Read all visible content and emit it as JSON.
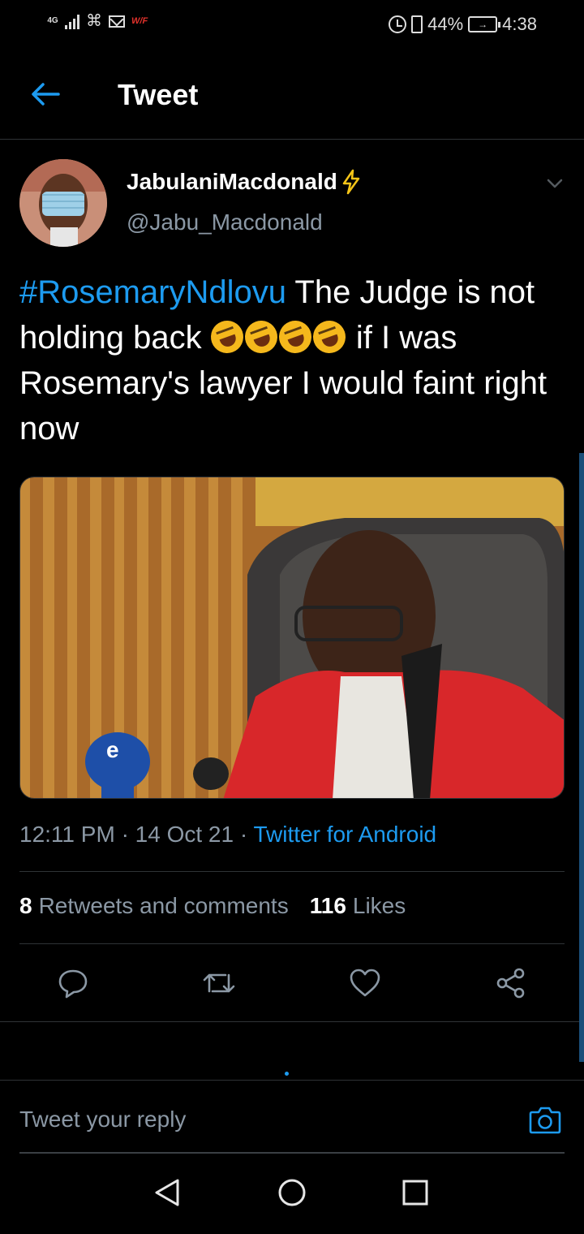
{
  "status_bar": {
    "network": "4G",
    "wifi_label": "W/F",
    "battery_percent": "44%",
    "time": "4:38"
  },
  "header": {
    "title": "Tweet"
  },
  "tweet": {
    "display_name": "JabulaniMacdonald",
    "handle": "@Jabu_Macdonald",
    "hashtag": "#RosemaryNdlovu",
    "text_part1": " The Judge is not holding back ",
    "text_part2": " if I was Rosemary's lawyer I would faint right now",
    "time": "12:11 PM",
    "date": "14 Oct 21",
    "source": "Twitter for Android",
    "retweets_count": "8",
    "retweets_label": "Retweets and comments",
    "likes_count": "116",
    "likes_label": "Likes"
  },
  "reply": {
    "placeholder": "Tweet your reply"
  },
  "colors": {
    "accent": "#1d9bf0",
    "background": "#000000",
    "secondary_text": "#8b98a5"
  },
  "icons": {
    "emoji": "rolling-on-the-floor-laughing",
    "verified": "lightning-bolt"
  }
}
